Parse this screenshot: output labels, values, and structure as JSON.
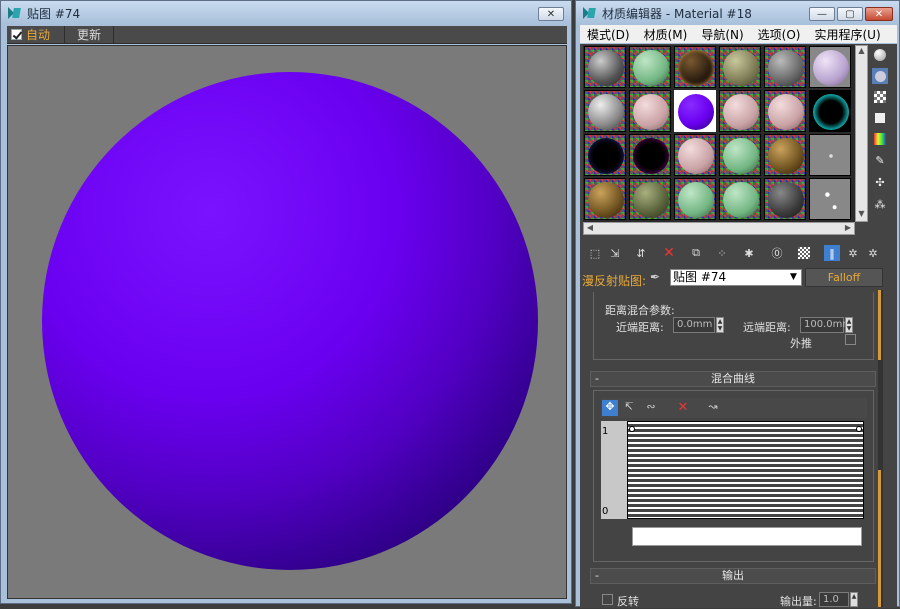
{
  "left_window": {
    "title": "贴图 #74",
    "close_label": "✕",
    "toolbar": {
      "auto_label": "自动",
      "auto_checked": true,
      "update_label": "更新"
    }
  },
  "right_window": {
    "title": "材质编辑器 - Material #18",
    "menu": [
      "模式(D)",
      "材质(M)",
      "导航(N)",
      "选项(O)",
      "实用程序(U)"
    ],
    "map_row": {
      "label": "漫反射贴图:",
      "map_name": "贴图 #74",
      "type_button": "Falloff"
    },
    "distance_blend": {
      "group_title": "距离混合参数:",
      "near_label": "近端距离:",
      "near_value": "0.0mm",
      "far_label": "远端距离:",
      "far_value": "100.0mm",
      "extrapolate_label": "外推",
      "extrapolate_checked": false
    },
    "mix_curve": {
      "rollout_title": "混合曲线",
      "collapse_sign": "-",
      "y_top": "1",
      "y_bottom": "0"
    },
    "output": {
      "rollout_title": "输出",
      "collapse_sign": "-",
      "invert_label": "反转",
      "amount_label": "输出量:",
      "amount_value": "1.0"
    }
  },
  "colors": {
    "preview_sphere": "#6a00f0",
    "preview_bg": "#7a7a7a",
    "accent": "#d79a3a"
  }
}
